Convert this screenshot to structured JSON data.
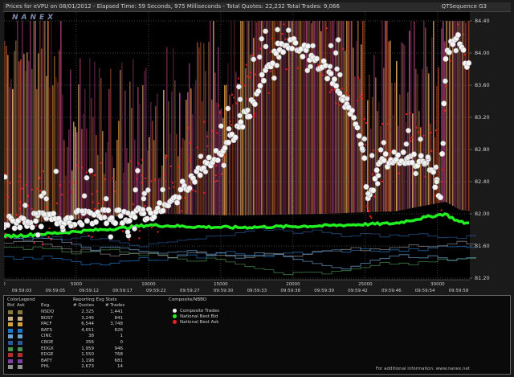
{
  "header": {
    "left": "Prices for eVPU on 08/01/2012  -  Elapsed Time: 59 Seconds, 975 Milliseconds  -  Total Quotes: 22,232  Total Trades: 9,066",
    "right": "QTSequence G3"
  },
  "watermark": "NANEX",
  "chart_data": {
    "type": "scatter",
    "y_ticks": [
      "84.40",
      "84.00",
      "83.60",
      "83.20",
      "82.80",
      "82.40",
      "82.00",
      "81.60",
      "81.20"
    ],
    "ylim": [
      81.2,
      84.4
    ],
    "x_seq_ticks": [
      "0",
      "5000",
      "10000",
      "15000",
      "20000",
      "25000",
      "30000"
    ],
    "x_time_ticks": [
      "09:59:03",
      "09:59:05",
      "09:59:12",
      "09:59:17",
      "09:59:22",
      "09:59:27",
      "09:59:30",
      "09:59:33",
      "09:59:38",
      "09:59:39",
      "09:59:42",
      "09:59:46",
      "09:59:54",
      "09:59:58"
    ],
    "xlim": [
      0,
      32232
    ],
    "series": [
      {
        "name": "Composite Trades",
        "color": "#f0f0f0"
      },
      {
        "name": "National Best Bid",
        "color": "#22ee22"
      },
      {
        "name": "National Best Ask",
        "color": "#ee2222"
      }
    ],
    "bid_path": [
      [
        0,
        81.72
      ],
      [
        2000,
        81.74
      ],
      [
        5000,
        81.78
      ],
      [
        8000,
        81.82
      ],
      [
        10000,
        81.86
      ],
      [
        13000,
        81.84
      ],
      [
        16000,
        81.83
      ],
      [
        19000,
        81.84
      ],
      [
        22000,
        81.85
      ],
      [
        25000,
        81.87
      ],
      [
        27000,
        81.88
      ],
      [
        29000,
        81.95
      ],
      [
        30500,
        82.0
      ],
      [
        31500,
        81.9
      ],
      [
        32232,
        81.88
      ]
    ],
    "trade_path": [
      [
        0,
        81.88
      ],
      [
        2000,
        81.92
      ],
      [
        5000,
        81.95
      ],
      [
        8000,
        81.97
      ],
      [
        10000,
        82.0
      ],
      [
        11500,
        82.1
      ],
      [
        12500,
        82.35
      ],
      [
        14000,
        82.6
      ],
      [
        15500,
        82.85
      ],
      [
        17000,
        83.3
      ],
      [
        18000,
        83.7
      ],
      [
        19000,
        84.05
      ],
      [
        20000,
        84.1
      ],
      [
        21000,
        84.0
      ],
      [
        22000,
        83.85
      ],
      [
        23000,
        83.6
      ],
      [
        24000,
        83.25
      ],
      [
        24800,
        82.9
      ],
      [
        25200,
        82.1
      ],
      [
        26000,
        82.65
      ],
      [
        28000,
        82.7
      ],
      [
        29500,
        82.6
      ],
      [
        30200,
        82.2
      ],
      [
        30600,
        84.0
      ],
      [
        31400,
        84.2
      ],
      [
        32232,
        83.8
      ]
    ]
  },
  "legend": {
    "headers": {
      "color_legend": "ColorLegend",
      "bid": "Bid",
      "ask": "Ask",
      "exchange": "Exg.",
      "reporting": "Reporting Exg Stats",
      "quotes": "# Quotes",
      "trades": "# Trades",
      "composite": "Composite/NBBO"
    },
    "rows": [
      {
        "exg": "NSDQ",
        "quotes": "2,325",
        "trades": "1,441",
        "color": "#8a7a3a"
      },
      {
        "exg": "BOST",
        "quotes": "3,246",
        "trades": "841",
        "color": "#c9b08a"
      },
      {
        "exg": "PACF",
        "quotes": "6,544",
        "trades": "3,748",
        "color": "#d7a040"
      },
      {
        "exg": "BATS",
        "quotes": "4,651",
        "trades": "826",
        "color": "#1e78c8"
      },
      {
        "exg": "CINC",
        "quotes": "38",
        "trades": "1",
        "color": "#6aa0d0"
      },
      {
        "exg": "CBOE",
        "quotes": "356",
        "trades": "0",
        "color": "#2a5a9a"
      },
      {
        "exg": "EDGX",
        "quotes": "1,959",
        "trades": "946",
        "color": "#4a9050"
      },
      {
        "exg": "EDGE",
        "quotes": "1,550",
        "trades": "768",
        "color": "#b03030"
      },
      {
        "exg": "BATY",
        "quotes": "1,198",
        "trades": "681",
        "color": "#8040a0"
      },
      {
        "exg": "PHL",
        "quotes": "2,673",
        "trades": "14",
        "color": "#909090"
      }
    ],
    "key": [
      {
        "label": "Composite Trades",
        "color": "#f0f0f0"
      },
      {
        "label": "National Best Bid",
        "color": "#22ee22"
      },
      {
        "label": "National Best Ask",
        "color": "#ee2222"
      }
    ],
    "footer": "For additional information: www.nanex.net"
  }
}
